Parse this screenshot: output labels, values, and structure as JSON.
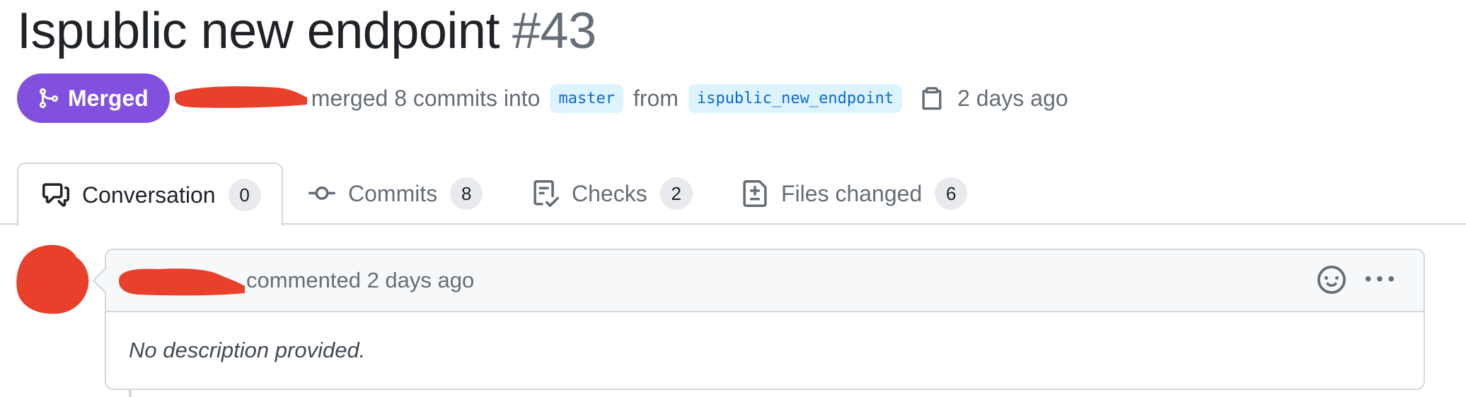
{
  "pr": {
    "title": "Ispublic new endpoint",
    "number": "#43",
    "status": "Merged",
    "merge_text": "merged 8 commits into",
    "base_branch": "master",
    "from_text": "from",
    "head_branch": "ispublic_new_endpoint",
    "time": "2 days ago"
  },
  "tabs": [
    {
      "label": "Conversation",
      "count": "0",
      "icon": "comment-discussion-icon",
      "active": true
    },
    {
      "label": "Commits",
      "count": "8",
      "icon": "git-commit-icon"
    },
    {
      "label": "Checks",
      "count": "2",
      "icon": "checklist-icon"
    },
    {
      "label": "Files changed",
      "count": "6",
      "icon": "file-diff-icon"
    }
  ],
  "comment": {
    "header_text": "commented 2 days ago",
    "body": "No description provided."
  },
  "colors": {
    "merged": "#8250df",
    "branch_bg": "#ddf4ff",
    "branch_fg": "#0969da",
    "redaction": "#e8402a"
  }
}
